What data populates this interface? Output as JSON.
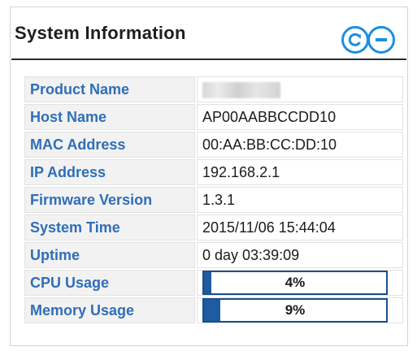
{
  "panel": {
    "title": "System Information",
    "refresh_icon": "refresh-icon",
    "collapse_icon": "minus-icon",
    "accent_color": "#1a8fe0"
  },
  "rows": [
    {
      "label": "Product Name",
      "value": ""
    },
    {
      "label": "Host Name",
      "value": "AP00AABBCCDD10"
    },
    {
      "label": "MAC Address",
      "value": "00:AA:BB:CC:DD:10"
    },
    {
      "label": "IP Address",
      "value": "192.168.2.1"
    },
    {
      "label": "Firmware Version",
      "value": "1.3.1"
    },
    {
      "label": "System Time",
      "value": "2015/11/06 15:44:04"
    },
    {
      "label": "Uptime",
      "value": "0 day 03:39:09"
    }
  ],
  "usage": [
    {
      "label": "CPU Usage",
      "text": "4%",
      "percent": 4
    },
    {
      "label": "Memory Usage",
      "text": "9%",
      "percent": 9
    }
  ],
  "colors": {
    "label_text": "#2f6eb9",
    "bar_fill": "#1e5ba1",
    "bar_border": "#1d4e8a"
  }
}
